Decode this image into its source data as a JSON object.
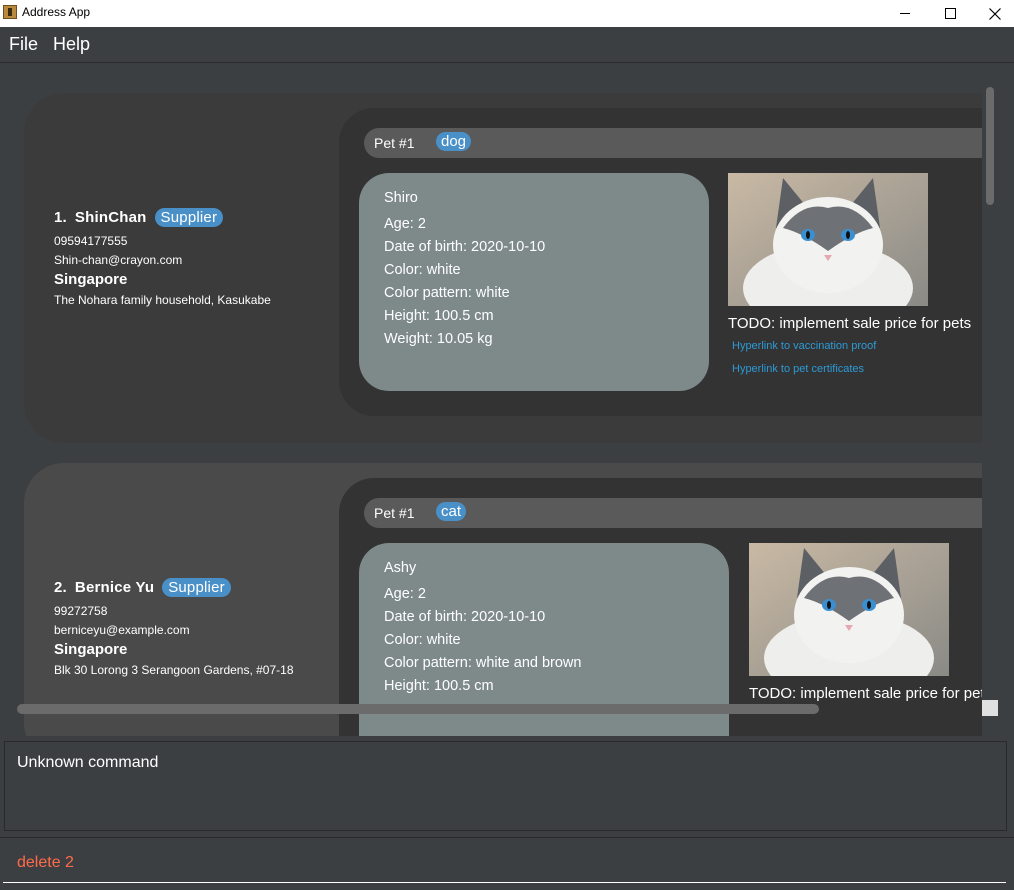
{
  "window": {
    "title": "Address App"
  },
  "menu": {
    "items": [
      "File",
      "Help"
    ]
  },
  "persons": [
    {
      "index": "1.",
      "name": "ShinChan",
      "tag": "Supplier",
      "phone": "09594177555",
      "email": "Shin-chan@crayon.com",
      "city": "Singapore",
      "address": "The Nohara family household, Kasukabe",
      "pet": {
        "number": "Pet #1",
        "species": "dog",
        "name": "Shiro",
        "age": "Age: 2",
        "dob": "Date of birth: 2020-10-10",
        "color": "Color: white",
        "pattern": "Color pattern: white",
        "height": "Height: 100.5 cm",
        "weight": "Weight: 10.05 kg",
        "todo": "TODO: implement sale price for pets",
        "link_vaccination": "Hyperlink to vaccination proof",
        "link_certificates": "Hyperlink to pet certificates"
      }
    },
    {
      "index": "2.",
      "name": "Bernice Yu",
      "tag": "Supplier",
      "phone": "99272758",
      "email": "berniceyu@example.com",
      "city": "Singapore",
      "address": "Blk 30 Lorong 3 Serangoon Gardens, #07-18",
      "pet": {
        "number": "Pet #1",
        "species": "cat",
        "name": "Ashy",
        "age": "Age: 2",
        "dob": "Date of birth: 2020-10-10",
        "color": "Color: white",
        "pattern": "Color pattern: white and brown",
        "height": "Height: 100.5 cm",
        "todo": "TODO: implement sale price for pet"
      }
    }
  ],
  "result": {
    "text": "Unknown command"
  },
  "command": {
    "text": "delete 2"
  },
  "colors": {
    "tag": "#4a90c8",
    "link": "#2d9ad6",
    "error_command": "#ff6b4a"
  }
}
